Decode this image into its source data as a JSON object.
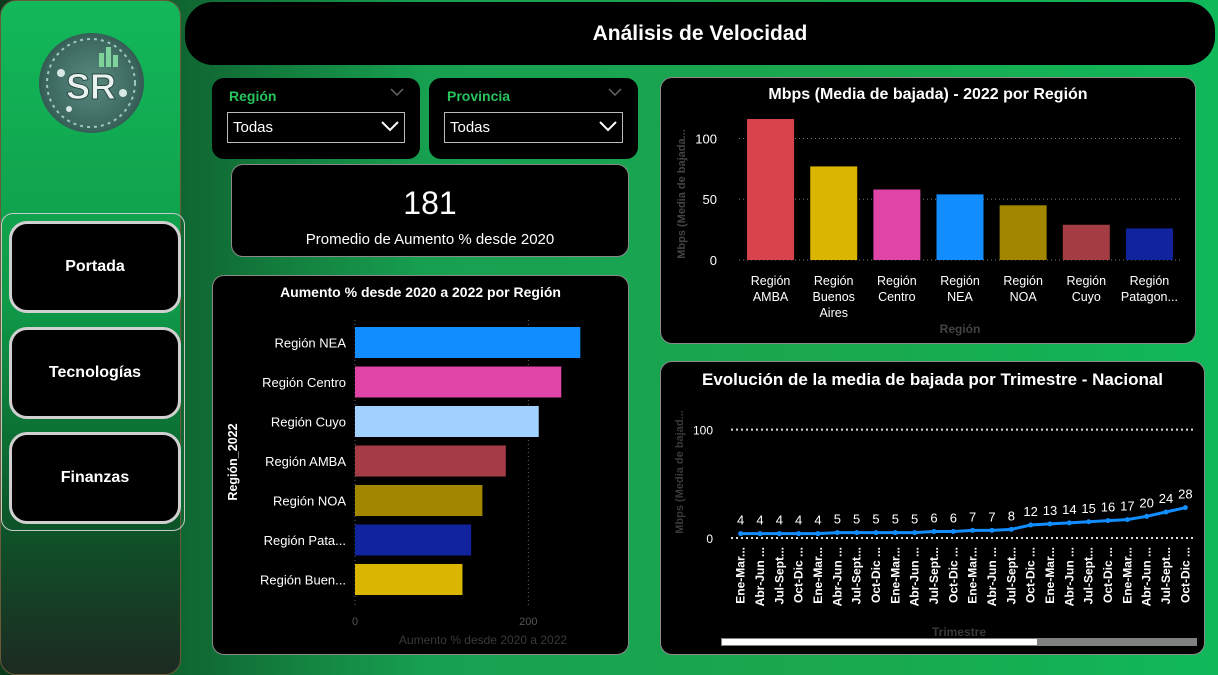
{
  "header": {
    "title": "Análisis de Velocidad"
  },
  "sidebar": {
    "logo_text": "SR",
    "nav": [
      {
        "label": "Portada"
      },
      {
        "label": "Tecnologías"
      },
      {
        "label": "Finanzas"
      }
    ]
  },
  "filters": {
    "region": {
      "title": "Región",
      "value": "Todas"
    },
    "provincia": {
      "title": "Provincia",
      "value": "Todas"
    }
  },
  "kpi": {
    "value": "181",
    "label": "Promedio de Aumento % desde 2020"
  },
  "colors": {
    "nea": "#118dff",
    "centro": "#e044a7",
    "cuyo": "#a0d1ff",
    "amba": "#a43b45",
    "noa": "#a38600",
    "patagonia": "#12239e",
    "buenos_aires": "#dab600",
    "amba_bar": "#d9434e",
    "cuyo_bar": "#a33d43",
    "accent_green": "#27c35c"
  },
  "chart_data": [
    {
      "type": "bar",
      "title": "Mbps (Media de bajada) - 2022 por Región",
      "xlabel": "Región",
      "ylabel": "Mbps (Media de bajada...",
      "categories": [
        "Región AMBA",
        "Región Buenos Aires",
        "Región Centro",
        "Región NEA",
        "Región NOA",
        "Región Cuyo",
        "Región Patagon..."
      ],
      "values": [
        116,
        77,
        58,
        54,
        45,
        29,
        26
      ],
      "ylim": [
        0,
        130
      ],
      "yticks": [
        0,
        50,
        100
      ]
    },
    {
      "type": "bar",
      "orientation": "horizontal",
      "title": "Aumento % desde 2020 a 2022 por Región",
      "xlabel": "Aumento % desde 2020 a 2022",
      "ylabel": "Región_2022",
      "categories": [
        "Región NEA",
        "Región Centro",
        "Región Cuyo",
        "Región AMBA",
        "Región NOA",
        "Región Pata...",
        "Región Buen..."
      ],
      "values": [
        260,
        238,
        212,
        174,
        147,
        134,
        124
      ],
      "xlim": [
        0,
        300
      ],
      "xticks": [
        0,
        200
      ]
    },
    {
      "type": "line",
      "title": "Evolución de la media de bajada por Trimestre - Nacional",
      "xlabel": "Trimestre",
      "ylabel": "Mbps (Media de bajad...",
      "x": [
        "Ene-Mar...",
        "Abr-Jun ...",
        "Jul-Sept...",
        "Oct-Dic ...",
        "Ene-Mar...",
        "Abr-Jun ...",
        "Jul-Sept...",
        "Oct-Dic ...",
        "Ene-Mar...",
        "Abr-Jun ...",
        "Jul-Sept...",
        "Oct-Dic ...",
        "Ene-Mar...",
        "Abr-Jun ...",
        "Jul-Sept...",
        "Oct-Dic ...",
        "Ene-Mar...",
        "Abr-Jun ...",
        "Jul-Sept...",
        "Oct-Dic ...",
        "Ene-Mar...",
        "Abr-Jun ...",
        "Jul-Sept...",
        "Oct-Dic ..."
      ],
      "values": [
        4,
        4,
        4,
        4,
        4,
        5,
        5,
        5,
        5,
        5,
        6,
        6,
        7,
        7,
        8,
        12,
        13,
        14,
        15,
        16,
        17,
        20,
        24,
        28
      ],
      "ylim": [
        0,
        120
      ],
      "yticks": [
        0,
        100
      ],
      "grid": true
    }
  ]
}
